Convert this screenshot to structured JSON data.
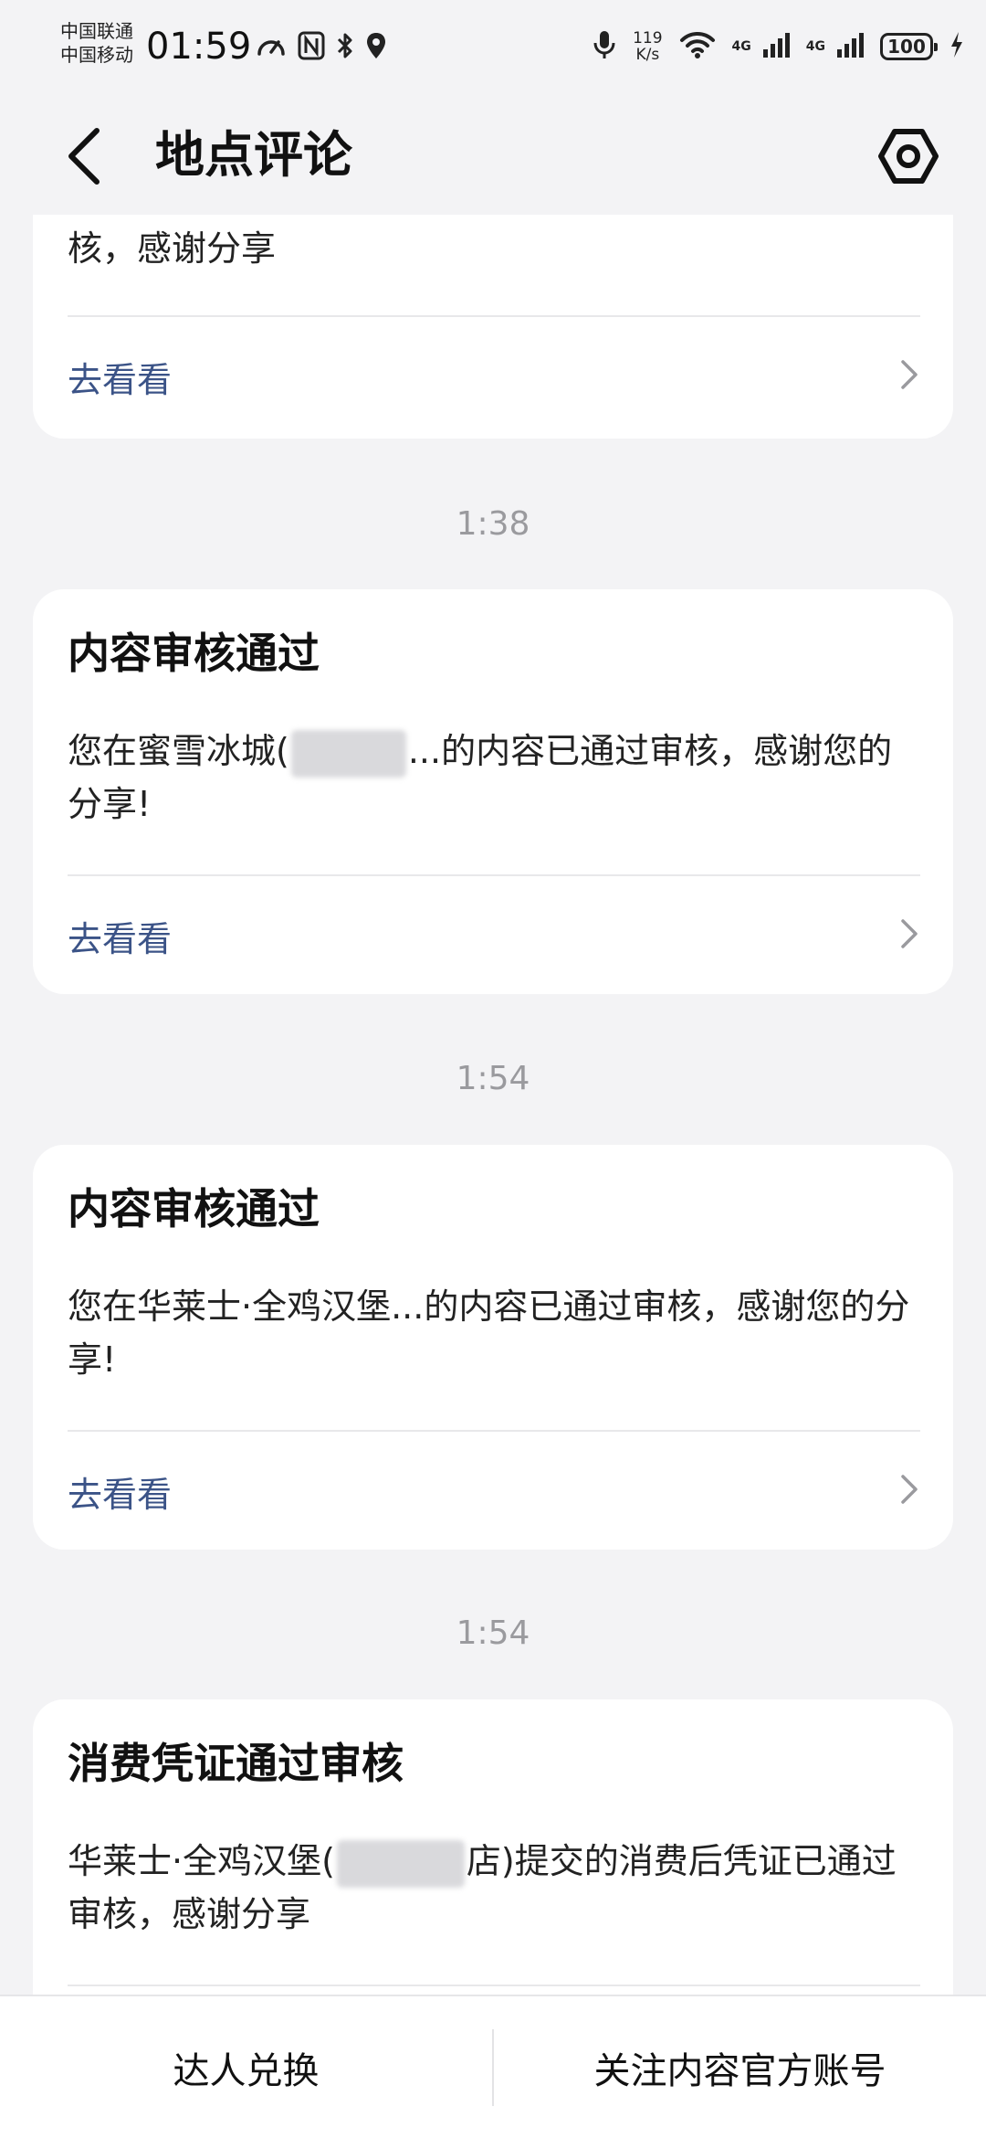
{
  "status_bar": {
    "carrier_1": "中国联通",
    "carrier_2": "中国移动",
    "time": "01:59",
    "net_speed_value": "119",
    "net_speed_unit": "K/s",
    "network_1": "4G",
    "network_2": "4G",
    "battery": "100"
  },
  "header": {
    "title": "地点评论",
    "back_icon": "chevron-left-icon",
    "settings_icon": "settings-icon"
  },
  "messages": [
    {
      "partial": true,
      "body": "核，感谢分享",
      "link_label": "去看看"
    },
    {
      "time": "1:38",
      "title": "内容审核通过",
      "body_before": "您在蜜雪冰城(",
      "body_after": "...的内容已通过审核，感谢您的分享!",
      "link_label": "去看看"
    },
    {
      "time": "1:54",
      "title": "内容审核通过",
      "body": "您在华莱士·全鸡汉堡...的内容已通过审核，感谢您的分享!",
      "link_label": "去看看"
    },
    {
      "time": "1:54",
      "title": "消费凭证通过审核",
      "body_before": "华莱士·全鸡汉堡(",
      "body_after": "店)提交的消费后凭证已通过审核，感谢分享"
    }
  ],
  "bottom_bar": {
    "left_label": "达人兑换",
    "right_label": "关注内容官方账号"
  },
  "colors": {
    "background": "#f3f3f5",
    "card": "#ffffff",
    "link": "#3b5387",
    "time": "#9a9a9e"
  }
}
